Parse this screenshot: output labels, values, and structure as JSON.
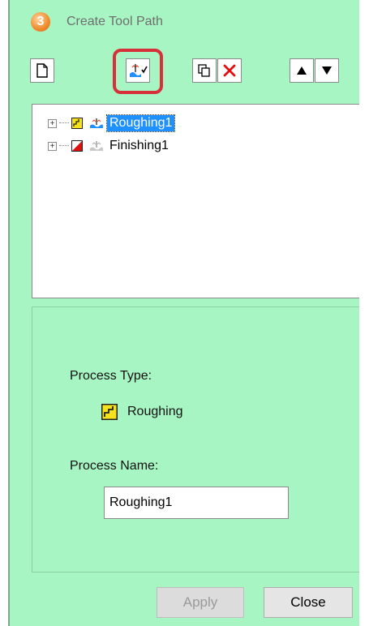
{
  "window": {
    "title": "Create Tool Path",
    "app_badge": "3"
  },
  "toolbar": {
    "buttons": [
      {
        "name": "new-document-icon"
      },
      {
        "name": "toolpath-generate-icon"
      },
      {
        "name": "copy-icon"
      },
      {
        "name": "delete-icon"
      },
      {
        "name": "move-up-icon"
      },
      {
        "name": "move-down-icon"
      }
    ],
    "colors": {
      "delete": "#e01010",
      "highlight": "#d8303a"
    }
  },
  "tree": {
    "items": [
      {
        "label": "Roughing1",
        "selected": true
      },
      {
        "label": "Finishing1",
        "selected": false
      }
    ]
  },
  "panel": {
    "process_type_label": "Process Type:",
    "process_type_value": "Roughing",
    "process_name_label": "Process Name:",
    "process_name_value": "Roughing1"
  },
  "buttons": {
    "apply": "Apply",
    "close": "Close"
  },
  "colors": {
    "background": "#a8f5c4",
    "selection": "#1e90ff"
  }
}
